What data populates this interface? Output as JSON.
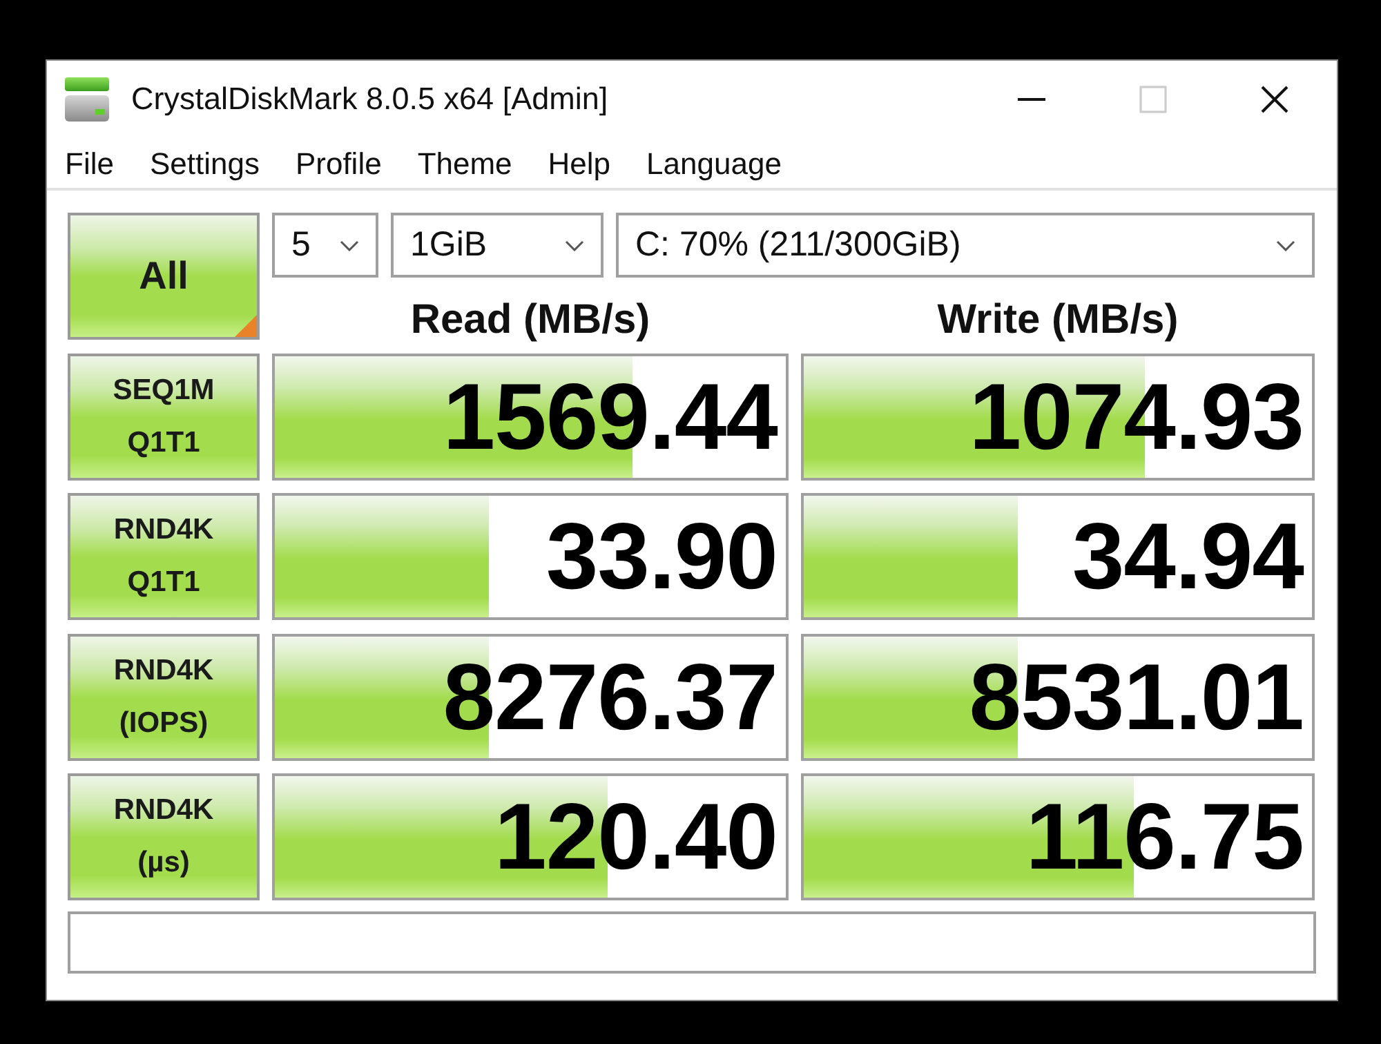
{
  "window": {
    "title": "CrystalDiskMark 8.0.5 x64 [Admin]",
    "controls": [
      {
        "kind": "minimize",
        "disabled": false
      },
      {
        "kind": "maximize",
        "disabled": true
      },
      {
        "kind": "close",
        "disabled": false
      }
    ]
  },
  "menu": [
    "File",
    "Settings",
    "Profile",
    "Theme",
    "Help",
    "Language"
  ],
  "all_button": {
    "label": "All"
  },
  "selects": [
    {
      "value": "5"
    },
    {
      "value": "1GiB"
    },
    {
      "value": "C: 70% (211/300GiB)"
    }
  ],
  "columns": [
    "Read (MB/s)",
    "Write (MB/s)"
  ],
  "rows": [
    {
      "label": [
        "SEQ1M",
        "Q1T1"
      ],
      "read": {
        "value": "1569.44",
        "level": 0.7
      },
      "write": {
        "value": "1074.93",
        "level": 0.67
      }
    },
    {
      "label": [
        "RND4K",
        "Q1T1"
      ],
      "read": {
        "value": "33.90",
        "level": 0.42
      },
      "write": {
        "value": "34.94",
        "level": 0.42
      }
    },
    {
      "label": [
        "RND4K",
        "(IOPS)"
      ],
      "read": {
        "value": "8276.37",
        "level": 0.42
      },
      "write": {
        "value": "8531.01",
        "level": 0.42
      }
    },
    {
      "label": [
        "RND4K",
        "(µs)"
      ],
      "read": {
        "value": "120.40",
        "level": 0.65
      },
      "write": {
        "value": "116.75",
        "level": 0.65
      }
    }
  ]
}
